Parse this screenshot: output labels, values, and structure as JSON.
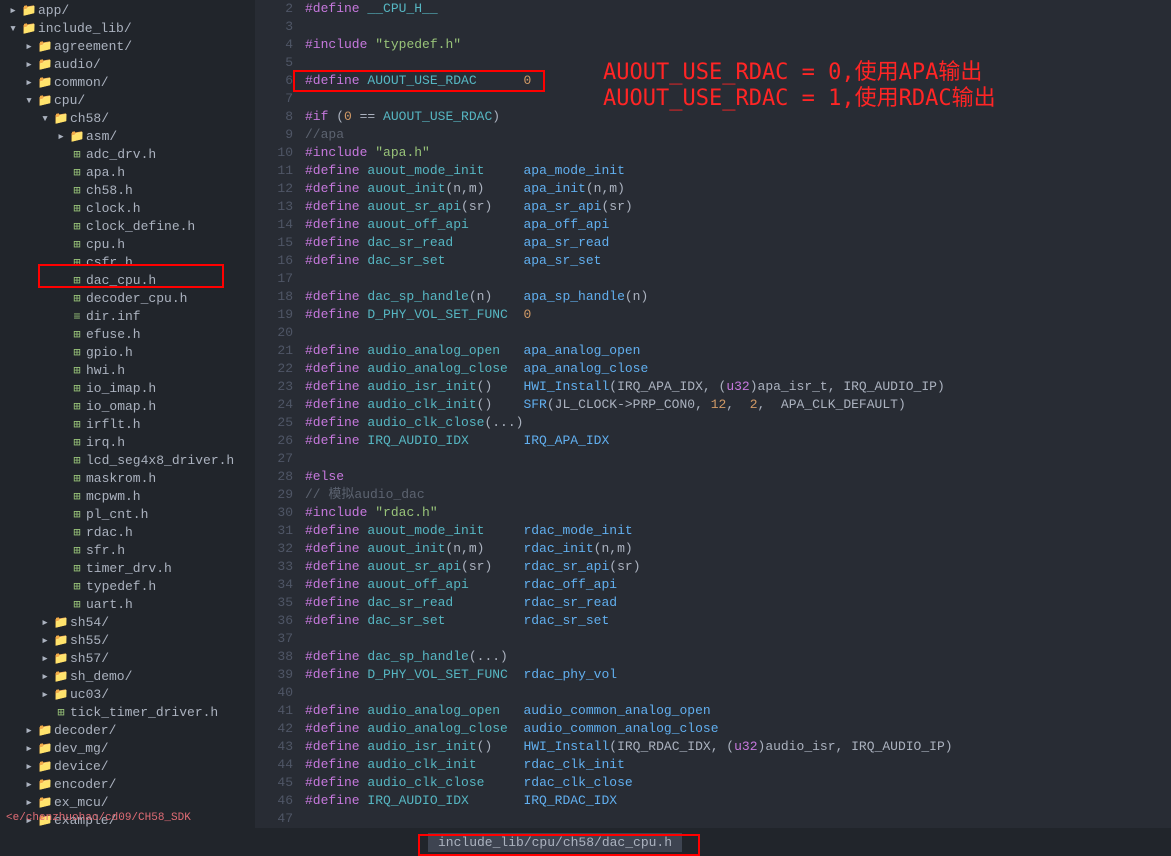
{
  "tree": [
    {
      "depth": 0,
      "exp": "▸",
      "icon": "📁",
      "name": "app/",
      "kind": "folder"
    },
    {
      "depth": 0,
      "exp": "▾",
      "icon": "📁",
      "name": "include_lib/",
      "kind": "folder"
    },
    {
      "depth": 1,
      "exp": "▸",
      "icon": "📁",
      "name": "agreement/",
      "kind": "folder"
    },
    {
      "depth": 1,
      "exp": "▸",
      "icon": "📁",
      "name": "audio/",
      "kind": "folder"
    },
    {
      "depth": 1,
      "exp": "▸",
      "icon": "📁",
      "name": "common/",
      "kind": "folder"
    },
    {
      "depth": 1,
      "exp": "▾",
      "icon": "📁",
      "name": "cpu/",
      "kind": "folder"
    },
    {
      "depth": 2,
      "exp": "▾",
      "icon": "📁",
      "name": "ch58/",
      "kind": "folder"
    },
    {
      "depth": 3,
      "exp": "▸",
      "icon": "📁",
      "name": "asm/",
      "kind": "folder"
    },
    {
      "depth": 3,
      "exp": "",
      "icon": "⊞",
      "name": "adc_drv.h",
      "kind": "h"
    },
    {
      "depth": 3,
      "exp": "",
      "icon": "⊞",
      "name": "apa.h",
      "kind": "h"
    },
    {
      "depth": 3,
      "exp": "",
      "icon": "⊞",
      "name": "ch58.h",
      "kind": "h"
    },
    {
      "depth": 3,
      "exp": "",
      "icon": "⊞",
      "name": "clock.h",
      "kind": "h"
    },
    {
      "depth": 3,
      "exp": "",
      "icon": "⊞",
      "name": "clock_define.h",
      "kind": "h"
    },
    {
      "depth": 3,
      "exp": "",
      "icon": "⊞",
      "name": "cpu.h",
      "kind": "h"
    },
    {
      "depth": 3,
      "exp": "",
      "icon": "⊞",
      "name": "csfr.h",
      "kind": "h"
    },
    {
      "depth": 3,
      "exp": "",
      "icon": "⊞",
      "name": "dac_cpu.h",
      "kind": "h",
      "hl": true
    },
    {
      "depth": 3,
      "exp": "",
      "icon": "⊞",
      "name": "decoder_cpu.h",
      "kind": "h"
    },
    {
      "depth": 3,
      "exp": "",
      "icon": "≡",
      "name": "dir.inf",
      "kind": "txt"
    },
    {
      "depth": 3,
      "exp": "",
      "icon": "⊞",
      "name": "efuse.h",
      "kind": "h"
    },
    {
      "depth": 3,
      "exp": "",
      "icon": "⊞",
      "name": "gpio.h",
      "kind": "h"
    },
    {
      "depth": 3,
      "exp": "",
      "icon": "⊞",
      "name": "hwi.h",
      "kind": "h"
    },
    {
      "depth": 3,
      "exp": "",
      "icon": "⊞",
      "name": "io_imap.h",
      "kind": "h"
    },
    {
      "depth": 3,
      "exp": "",
      "icon": "⊞",
      "name": "io_omap.h",
      "kind": "h"
    },
    {
      "depth": 3,
      "exp": "",
      "icon": "⊞",
      "name": "irflt.h",
      "kind": "h"
    },
    {
      "depth": 3,
      "exp": "",
      "icon": "⊞",
      "name": "irq.h",
      "kind": "h"
    },
    {
      "depth": 3,
      "exp": "",
      "icon": "⊞",
      "name": "lcd_seg4x8_driver.h",
      "kind": "h"
    },
    {
      "depth": 3,
      "exp": "",
      "icon": "⊞",
      "name": "maskrom.h",
      "kind": "h"
    },
    {
      "depth": 3,
      "exp": "",
      "icon": "⊞",
      "name": "mcpwm.h",
      "kind": "h"
    },
    {
      "depth": 3,
      "exp": "",
      "icon": "⊞",
      "name": "pl_cnt.h",
      "kind": "h"
    },
    {
      "depth": 3,
      "exp": "",
      "icon": "⊞",
      "name": "rdac.h",
      "kind": "h"
    },
    {
      "depth": 3,
      "exp": "",
      "icon": "⊞",
      "name": "sfr.h",
      "kind": "h"
    },
    {
      "depth": 3,
      "exp": "",
      "icon": "⊞",
      "name": "timer_drv.h",
      "kind": "h"
    },
    {
      "depth": 3,
      "exp": "",
      "icon": "⊞",
      "name": "typedef.h",
      "kind": "h"
    },
    {
      "depth": 3,
      "exp": "",
      "icon": "⊞",
      "name": "uart.h",
      "kind": "h"
    },
    {
      "depth": 2,
      "exp": "▸",
      "icon": "📁",
      "name": "sh54/",
      "kind": "folder"
    },
    {
      "depth": 2,
      "exp": "▸",
      "icon": "📁",
      "name": "sh55/",
      "kind": "folder"
    },
    {
      "depth": 2,
      "exp": "▸",
      "icon": "📁",
      "name": "sh57/",
      "kind": "folder"
    },
    {
      "depth": 2,
      "exp": "▸",
      "icon": "📁",
      "name": "sh_demo/",
      "kind": "folder"
    },
    {
      "depth": 2,
      "exp": "▸",
      "icon": "📁",
      "name": "uc03/",
      "kind": "folder"
    },
    {
      "depth": 2,
      "exp": "",
      "icon": "⊞",
      "name": "tick_timer_driver.h",
      "kind": "h"
    },
    {
      "depth": 1,
      "exp": "▸",
      "icon": "📁",
      "name": "decoder/",
      "kind": "folder"
    },
    {
      "depth": 1,
      "exp": "▸",
      "icon": "📁",
      "name": "dev_mg/",
      "kind": "folder"
    },
    {
      "depth": 1,
      "exp": "▸",
      "icon": "📁",
      "name": "device/",
      "kind": "folder"
    },
    {
      "depth": 1,
      "exp": "▸",
      "icon": "📁",
      "name": "encoder/",
      "kind": "folder"
    },
    {
      "depth": 1,
      "exp": "▸",
      "icon": "📁",
      "name": "ex_mcu/",
      "kind": "folder"
    },
    {
      "depth": 1,
      "exp": "▸",
      "icon": "📁",
      "name": "example/",
      "kind": "folder"
    }
  ],
  "breadcrumb": "<e/chenzhuohao/cd09/CH58_SDK",
  "code": [
    {
      "n": 2,
      "html": "<span class='k-pp'>#define</span> <span class='ident'>__CPU_H__</span>"
    },
    {
      "n": 3,
      "html": ""
    },
    {
      "n": 4,
      "html": "<span class='k-inc'>#include</span> <span class='str'>\"typedef.h\"</span>"
    },
    {
      "n": 5,
      "html": ""
    },
    {
      "n": 6,
      "html": "<span class='k-pp'>#define</span> <span class='ident'>AUOUT_USE_RDAC</span>      <span class='num'>0</span>"
    },
    {
      "n": 7,
      "html": ""
    },
    {
      "n": 8,
      "html": "<span class='k-pp'>#if</span> (<span class='num'>0</span> == <span class='ident'>AUOUT_USE_RDAC</span>)"
    },
    {
      "n": 9,
      "html": "<span class='comm'>//apa</span>"
    },
    {
      "n": 10,
      "html": "<span class='k-inc'>#include</span> <span class='str'>\"apa.h\"</span>"
    },
    {
      "n": 11,
      "html": "<span class='k-pp'>#define</span> <span class='ident'>auout_mode_init</span>     <span class='fn'>apa_mode_init</span>"
    },
    {
      "n": 12,
      "html": "<span class='k-pp'>#define</span> <span class='ident'>auout_init</span>(n,m)     <span class='fn'>apa_init</span>(n,m)"
    },
    {
      "n": 13,
      "html": "<span class='k-pp'>#define</span> <span class='ident'>auout_sr_api</span>(sr)    <span class='fn'>apa_sr_api</span>(sr)"
    },
    {
      "n": 14,
      "html": "<span class='k-pp'>#define</span> <span class='ident'>auout_off_api</span>       <span class='fn'>apa_off_api</span>"
    },
    {
      "n": 15,
      "html": "<span class='k-pp'>#define</span> <span class='ident'>dac_sr_read</span>         <span class='fn'>apa_sr_read</span>"
    },
    {
      "n": 16,
      "html": "<span class='k-pp'>#define</span> <span class='ident'>dac_sr_set</span>          <span class='fn'>apa_sr_set</span>"
    },
    {
      "n": 17,
      "html": ""
    },
    {
      "n": 18,
      "html": "<span class='k-pp'>#define</span> <span class='ident'>dac_sp_handle</span>(n)    <span class='fn'>apa_sp_handle</span>(n)"
    },
    {
      "n": 19,
      "html": "<span class='k-pp'>#define</span> <span class='ident'>D_PHY_VOL_SET_FUNC</span>  <span class='num'>0</span>"
    },
    {
      "n": 20,
      "html": ""
    },
    {
      "n": 21,
      "html": "<span class='k-pp'>#define</span> <span class='ident'>audio_analog_open</span>   <span class='fn'>apa_analog_open</span>"
    },
    {
      "n": 22,
      "html": "<span class='k-pp'>#define</span> <span class='ident'>audio_analog_close</span>  <span class='fn'>apa_analog_close</span>"
    },
    {
      "n": 23,
      "html": "<span class='k-pp'>#define</span> <span class='ident'>audio_isr_init</span>()    <span class='fn'>HWI_Install</span>(IRQ_APA_IDX, (<span class='type'>u32</span>)apa_isr_t, IRQ_AUDIO_IP)"
    },
    {
      "n": 24,
      "html": "<span class='k-pp'>#define</span> <span class='ident'>audio_clk_init</span>()    <span class='fn'>SFR</span>(JL_CLOCK->PRP_CON0, <span class='num'>12</span>,  <span class='num'>2</span>,  APA_CLK_DEFAULT)"
    },
    {
      "n": 25,
      "html": "<span class='k-pp'>#define</span> <span class='ident'>audio_clk_close</span>(...)"
    },
    {
      "n": 26,
      "html": "<span class='k-pp'>#define</span> <span class='ident'>IRQ_AUDIO_IDX</span>       <span class='fn'>IRQ_APA_IDX</span>"
    },
    {
      "n": 27,
      "html": ""
    },
    {
      "n": 28,
      "html": "<span class='k-pp'>#else</span>"
    },
    {
      "n": 29,
      "html": "<span class='comm'>// 模拟audio_dac</span>"
    },
    {
      "n": 30,
      "html": "<span class='k-inc'>#include</span> <span class='str'>\"rdac.h\"</span>"
    },
    {
      "n": 31,
      "html": "<span class='k-pp'>#define</span> <span class='ident'>auout_mode_init</span>     <span class='fn'>rdac_mode_init</span>"
    },
    {
      "n": 32,
      "html": "<span class='k-pp'>#define</span> <span class='ident'>auout_init</span>(n,m)     <span class='fn'>rdac_init</span>(n,m)"
    },
    {
      "n": 33,
      "html": "<span class='k-pp'>#define</span> <span class='ident'>auout_sr_api</span>(sr)    <span class='fn'>rdac_sr_api</span>(sr)"
    },
    {
      "n": 34,
      "html": "<span class='k-pp'>#define</span> <span class='ident'>auout_off_api</span>       <span class='fn'>rdac_off_api</span>"
    },
    {
      "n": 35,
      "html": "<span class='k-pp'>#define</span> <span class='ident'>dac_sr_read</span>         <span class='fn'>rdac_sr_read</span>"
    },
    {
      "n": 36,
      "html": "<span class='k-pp'>#define</span> <span class='ident'>dac_sr_set</span>          <span class='fn'>rdac_sr_set</span>"
    },
    {
      "n": 37,
      "html": ""
    },
    {
      "n": 38,
      "html": "<span class='k-pp'>#define</span> <span class='ident'>dac_sp_handle</span>(...)"
    },
    {
      "n": 39,
      "html": "<span class='k-pp'>#define</span> <span class='ident'>D_PHY_VOL_SET_FUNC</span>  <span class='fn'>rdac_phy_vol</span>"
    },
    {
      "n": 40,
      "html": ""
    },
    {
      "n": 41,
      "html": "<span class='k-pp'>#define</span> <span class='ident'>audio_analog_open</span>   <span class='fn'>audio_common_analog_open</span>"
    },
    {
      "n": 42,
      "html": "<span class='k-pp'>#define</span> <span class='ident'>audio_analog_close</span>  <span class='fn'>audio_common_analog_close</span>"
    },
    {
      "n": 43,
      "html": "<span class='k-pp'>#define</span> <span class='ident'>audio_isr_init</span>()    <span class='fn'>HWI_Install</span>(IRQ_RDAC_IDX, (<span class='type'>u32</span>)audio_isr, IRQ_AUDIO_IP)"
    },
    {
      "n": 44,
      "html": "<span class='k-pp'>#define</span> <span class='ident'>audio_clk_init</span>      <span class='fn'>rdac_clk_init</span>"
    },
    {
      "n": 45,
      "html": "<span class='k-pp'>#define</span> <span class='ident'>audio_clk_close</span>     <span class='fn'>rdac_clk_close</span>"
    },
    {
      "n": 46,
      "html": "<span class='k-pp'>#define</span> <span class='ident'>IRQ_AUDIO_IDX</span>       <span class='fn'>IRQ_RDAC_IDX</span>"
    },
    {
      "n": 47,
      "html": ""
    }
  ],
  "annotations": {
    "line1": "AUOUT_USE_RDAC = 0,使用APA输出",
    "line2": "AUOUT_USE_RDAC = 1,使用RDAC输出"
  },
  "status_path": "include_lib/cpu/ch58/dac_cpu.h"
}
